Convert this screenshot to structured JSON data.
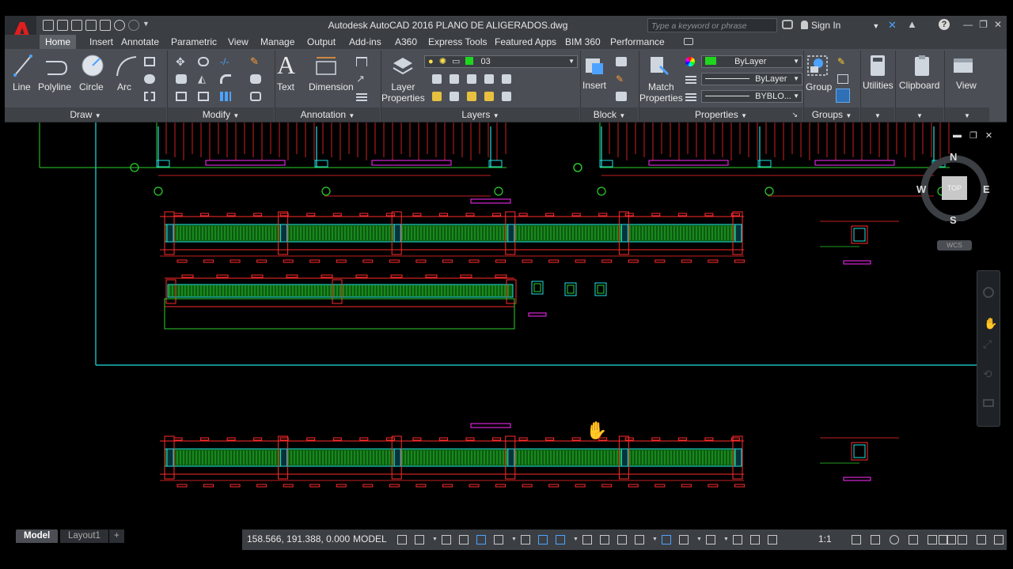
{
  "app": {
    "title": "Autodesk AutoCAD 2016    PLANO  DE ALIGERADOS.dwg",
    "search_placeholder": "Type a keyword or phrase",
    "sign_in": "Sign In",
    "help_icon": "?"
  },
  "tabs": [
    "Home",
    "Insert",
    "Annotate",
    "Parametric",
    "View",
    "Manage",
    "Output",
    "Add-ins",
    "A360",
    "Express Tools",
    "Featured Apps",
    "BIM 360",
    "Performance"
  ],
  "ribbon": {
    "draw": {
      "title": "Draw",
      "line": "Line",
      "polyline": "Polyline",
      "circle": "Circle",
      "arc": "Arc"
    },
    "modify": {
      "title": "Modify"
    },
    "annotation": {
      "title": "Annotation",
      "text": "Text",
      "dimension": "Dimension"
    },
    "layers": {
      "title": "Layers",
      "layer_properties": "Layer\nProperties",
      "layer_properties_l1": "Layer",
      "layer_properties_l2": "Properties",
      "current_layer": "03"
    },
    "block": {
      "title": "Block",
      "insert": "Insert"
    },
    "properties": {
      "title": "Properties",
      "match_l1": "Match",
      "match_l2": "Properties",
      "color": "ByLayer",
      "linetype": "ByLayer",
      "lineweight": "BYBLO..."
    },
    "groups": {
      "title": "Groups",
      "group": "Group"
    },
    "utilities": "Utilities",
    "clipboard": "Clipboard",
    "view": "View"
  },
  "viewcube": {
    "n": "N",
    "s": "S",
    "e": "E",
    "w": "W",
    "top": "TOP",
    "wcs": "WCS"
  },
  "layout_tabs": [
    "Model",
    "Layout1",
    "+"
  ],
  "status": {
    "coords": "158.566, 191.388, 0.000",
    "model": "MODEL",
    "scale": "1:1"
  },
  "colors": {
    "beam_red": "#ff2a2a",
    "rebar_green": "#2bd12b",
    "stirrup_cyan": "#20e0e0",
    "label_magenta": "#ff2bff",
    "ribbon_bg": "#4b4f55",
    "title_bg": "#3b3f44"
  }
}
